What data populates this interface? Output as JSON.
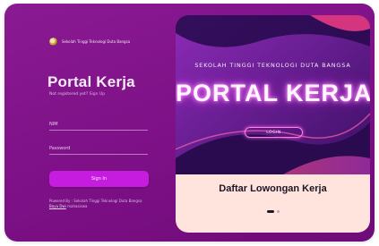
{
  "brand": {
    "name": "Sekolah Tinggi Teknologi Duta Bangsa",
    "logo_icon": "college-seal-icon"
  },
  "login": {
    "title": "Portal Kerja",
    "register_prefix": "Not registered yet?",
    "register_link": "Sign Up",
    "nim_label": "NIM",
    "password_label": "Password",
    "signin_label": "Sign In"
  },
  "footer": {
    "prefix": "Powered By : Sekolah Tinggi Teknologi Duta Bangsa",
    "credit_link": "Bayu Dwi",
    "credit_suffix": "mahasiswa"
  },
  "promo": {
    "school": "SEKOLAH TINGGI TEKNOLOGI DUTA BANGSA",
    "title": "PORTAL KERJA",
    "login_label": "LOGIN",
    "caption": "Daftar Lowongan Kerja",
    "slides": 2,
    "active_slide": 1
  },
  "colors": {
    "card": "#7d1086",
    "button": "#c61ce0",
    "caption_bg": "#ffe4dd",
    "neon": "#ff7fe8"
  }
}
